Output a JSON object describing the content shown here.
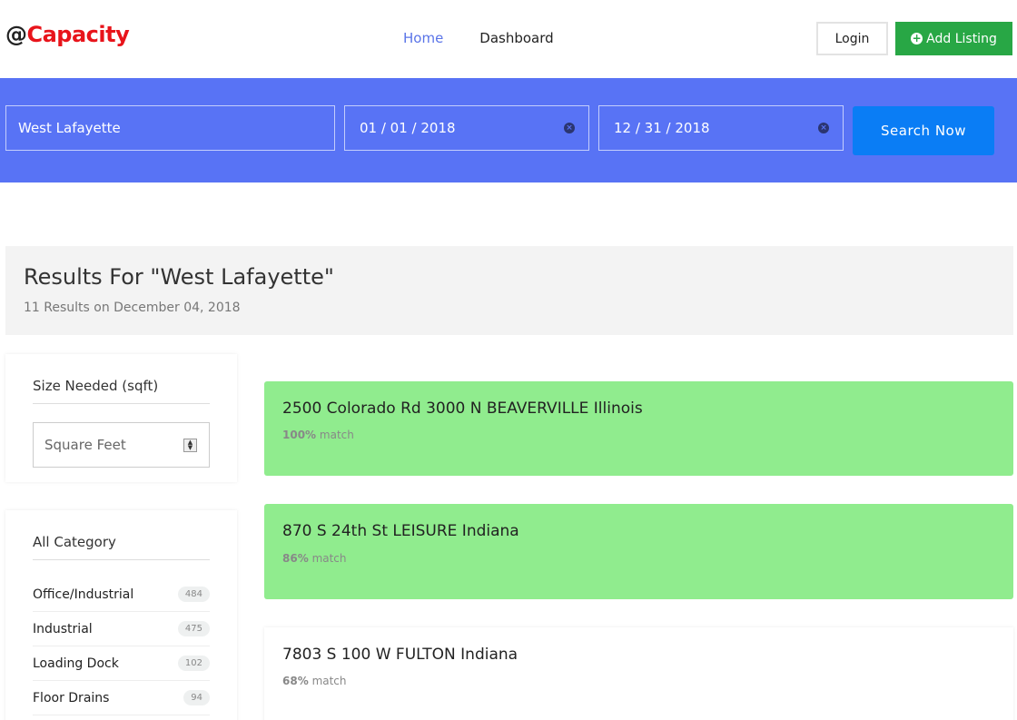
{
  "header": {
    "logo_at": "@",
    "logo_brand": "Capacity",
    "nav": [
      {
        "label": "Home",
        "active": true
      },
      {
        "label": "Dashboard",
        "active": false
      }
    ],
    "login_label": "Login",
    "add_listing_label": "Add Listing",
    "colors": {
      "brand_red": "#e8141b",
      "nav_active": "#5a74e8",
      "add_green": "#28a745"
    }
  },
  "search": {
    "location_value": "West Lafayette",
    "start_date": "01 / 01 / 2018",
    "end_date": "12 / 31 / 2018",
    "button_label": "Search Now",
    "colors": {
      "band": "#5873f5",
      "button": "#0a7df5"
    }
  },
  "results": {
    "title": "Results For \"West Lafayette\"",
    "subtitle": "11 Results on December 04, 2018"
  },
  "sidebar": {
    "size_title": "Size Needed (sqft)",
    "size_placeholder": "Square Feet",
    "category_title": "All Category",
    "categories": [
      {
        "label": "Office/Industrial",
        "count": "484"
      },
      {
        "label": "Industrial",
        "count": "475"
      },
      {
        "label": "Loading Dock",
        "count": "102"
      },
      {
        "label": "Floor Drains",
        "count": "94"
      }
    ]
  },
  "listings": [
    {
      "address": "2500 Colorado Rd 3000 N BEAVERVILLE Illinois",
      "match_pct": "100%",
      "match_word": "match",
      "highlight": true
    },
    {
      "address": "870 S 24th St LEISURE Indiana",
      "match_pct": "86%",
      "match_word": "match",
      "highlight": true
    },
    {
      "address": "7803 S 100 W FULTON Indiana",
      "match_pct": "68%",
      "match_word": "match",
      "highlight": false
    }
  ]
}
